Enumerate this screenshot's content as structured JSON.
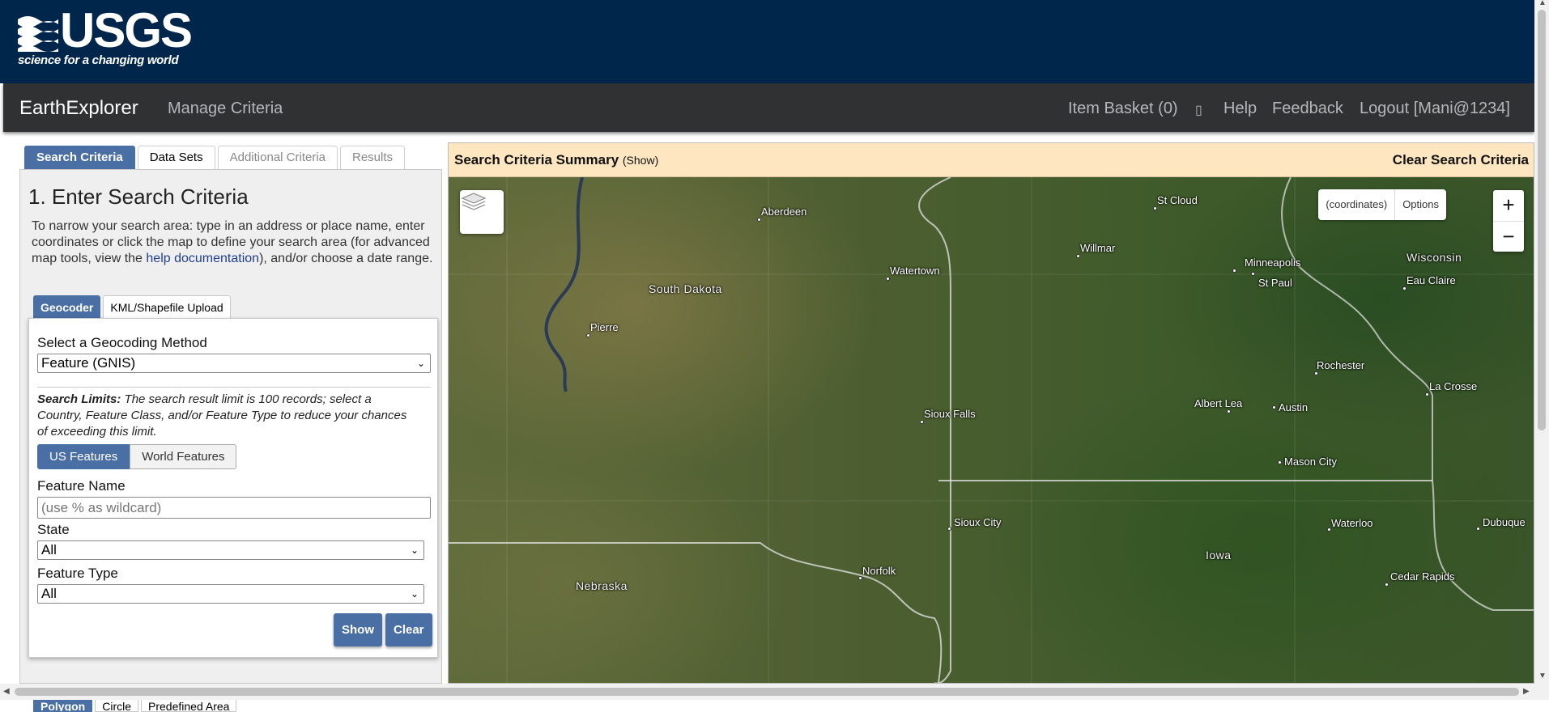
{
  "header": {
    "logo_text": "USGS",
    "logo_tagline": "science for a changing world"
  },
  "navbar": {
    "brand": "EarthExplorer",
    "manage": "Manage Criteria",
    "basket": "Item Basket (0)",
    "help": "Help",
    "feedback": "Feedback",
    "logout": "Logout [Mani@1234]"
  },
  "sidebar": {
    "tabs": [
      "Search Criteria",
      "Data Sets",
      "Additional Criteria",
      "Results"
    ],
    "heading": "1. Enter Search Criteria",
    "intro_before": "To narrow your search area: type in an address or place name, enter coordinates or click the map to define your search area (for advanced map tools, view the ",
    "intro_link": "help documentation",
    "intro_after": "), and/or choose a date range.",
    "subtabs": [
      "Geocoder",
      "KML/Shapefile Upload"
    ],
    "geocode_label": "Select a Geocoding Method",
    "geocode_value": "Feature (GNIS)",
    "limits_bold": "Search Limits:",
    "limits_text": " The search result limit is 100 records; select a Country, Feature Class, and/or Feature Type to reduce your chances of exceeding this limit.",
    "segment": [
      "US Features",
      "World Features"
    ],
    "feature_name_label": "Feature Name",
    "feature_name_placeholder": "(use % as wildcard)",
    "state_label": "State",
    "state_value": "All",
    "type_label": "Feature Type",
    "type_value": "All",
    "show_btn": "Show",
    "clear_btn": "Clear",
    "bottom_tabs": [
      "Polygon",
      "Circle",
      "Predefined Area"
    ]
  },
  "map": {
    "summary_title": "Search Criteria Summary",
    "summary_show": "(Show)",
    "clear_all": "Clear Search Criteria",
    "coords": "(coordinates)",
    "options": "Options",
    "zoom_in": "+",
    "zoom_out": "−",
    "cities": [
      "Aberdeen",
      "St Cloud",
      "Willmar",
      "Minneapolis",
      "St Paul",
      "Watertown",
      "Pierre",
      "Eau Claire",
      "Rochester",
      "La Crosse",
      "Albert Lea",
      "Austin",
      "Sioux Falls",
      "Mason City",
      "Sioux City",
      "Waterloo",
      "Dubuque",
      "Norfolk",
      "Cedar Rapids"
    ],
    "regions": [
      "South Dakota",
      "Wisconsin",
      "Iowa",
      "Nebraska"
    ]
  }
}
